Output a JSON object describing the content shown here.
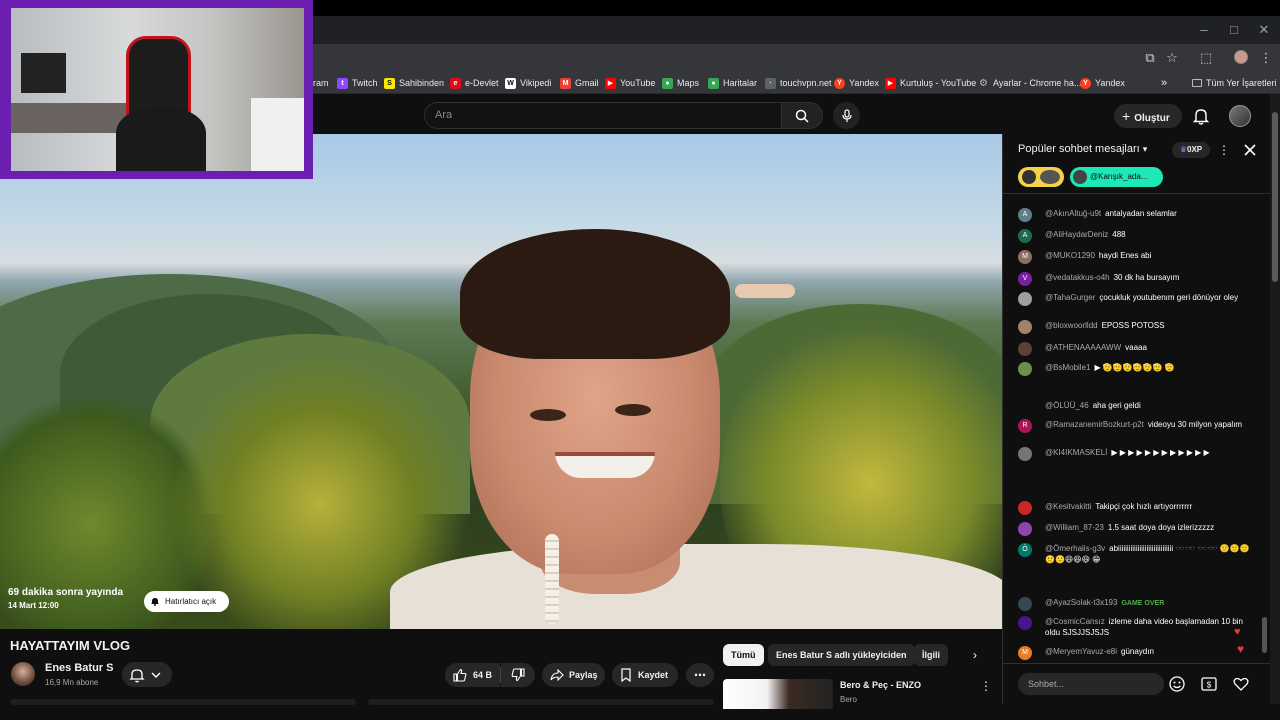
{
  "browser": {
    "window_controls": [
      "–",
      "□",
      "✕"
    ],
    "bookmarks": [
      {
        "label": "ram",
        "icon": "instagram-icon",
        "color": "#c13584"
      },
      {
        "label": "Twitch",
        "icon": "twitch-icon",
        "color": "#9146ff"
      },
      {
        "label": "Sahibinden",
        "icon": "sahibinden-icon",
        "color": "#ffe800"
      },
      {
        "label": "e-Devlet",
        "icon": "edevlet-icon",
        "color": "#e30a17"
      },
      {
        "label": "Vikipedi",
        "icon": "wikipedia-icon",
        "color": "#ffffff"
      },
      {
        "label": "Gmail",
        "icon": "gmail-icon",
        "color": "#ea4335"
      },
      {
        "label": "YouTube",
        "icon": "youtube-icon",
        "color": "#ff0000"
      },
      {
        "label": "Maps",
        "icon": "maps-icon",
        "color": "#34a853"
      },
      {
        "label": "Haritalar",
        "icon": "maps-icon",
        "color": "#34a853"
      },
      {
        "label": "touchvpn.net",
        "icon": "globe-icon",
        "color": "#5f6368"
      },
      {
        "label": "Yandex",
        "icon": "yandex-icon",
        "color": "#fc3f1d"
      },
      {
        "label": "Kurtuluş - YouTube",
        "icon": "youtube-icon",
        "color": "#ff0000"
      },
      {
        "label": "Ayarlar - Chrome ha...",
        "icon": "gear-icon",
        "color": "#9aa0a6"
      },
      {
        "label": "Yandex",
        "icon": "yandex-icon",
        "color": "#fc3f1d"
      }
    ],
    "more_bookmarks": "»",
    "all_bookmarks": "Tüm Yer İşaretleri"
  },
  "header": {
    "search_placeholder": "Ara",
    "create_label": "Oluştur"
  },
  "video": {
    "premiere_line1": "69 dakika sonra yayında",
    "premiere_line2": "14 Mart 12:00",
    "reminder_label": "Hatırlatıcı açık",
    "title": "HAYATTAYIM VLOG",
    "channel_name": "Enes Batur S",
    "channel_subs": "16,9 Mn abone",
    "like_count": "64 B",
    "share_label": "Paylaş",
    "save_label": "Kaydet"
  },
  "related": {
    "tabs": [
      "Tümü",
      "Enes Batur S adlı yükleyiciden",
      "İlgili"
    ],
    "first_title": "Bero & Peç - ENZO",
    "first_channel": "Bero"
  },
  "chat": {
    "header_title": "Popüler sohbet mesajları",
    "points_label": "0XP",
    "ticker_b_label": "@Karışık_ada...",
    "input_placeholder": "Sohbet...",
    "messages": [
      {
        "author": "@AkınAltuğ-u9t",
        "text": "antalyadan selamlar",
        "avatar": "A",
        "color": "#607d8b"
      },
      {
        "author": "@AliHaydarDeniz",
        "text": "488",
        "avatar": "A",
        "color": "#1e6b4a"
      },
      {
        "author": "@MUKO1290",
        "text": "haydi Enes abi",
        "avatar": "M",
        "color": "#8d6e63"
      },
      {
        "author": "@vedatakkus-o4h",
        "text": "30 dk ha bursayım",
        "avatar": "V",
        "color": "#7b1fa2"
      },
      {
        "author": "@TahaGurger",
        "text": "çocukluk youtubenım geri dönüyor oley",
        "avatar": "",
        "color": "#9e9e9e"
      },
      {
        "author": "@bloxwoorlldd",
        "text": "EPOSS POTOSS",
        "avatar": "",
        "color": "#a0836a"
      },
      {
        "author": "@ATHENAAAAAWW",
        "text": "vaaaa",
        "avatar": "",
        "color": "#5d4037"
      },
      {
        "author": "@BsMobile1",
        "text": "▶ 🫡🫡🫡🫡🫡🫡 🫡",
        "avatar": "",
        "color": "#6d8f4a"
      },
      {
        "author": "@ÖLÜÜ_46",
        "text": "aha geri geldi",
        "avatar": "",
        "color": "#0f0f0f"
      },
      {
        "author": "@RamazanemirBozkurt-p2t",
        "text": "videoyu 30 milyon yapalım",
        "avatar": "R",
        "color": "#ad1457"
      },
      {
        "author": "@KI4IKMASKELİ",
        "text": "▶ ▶ ▶ ▶ ▶ ▶ ▶ ▶ ▶ ▶ ▶ ▶",
        "avatar": "",
        "color": "#757575"
      },
      {
        "author": "@Kesitvakitti",
        "text": "Takipçi çok hızlı artıyorrrrrrr",
        "avatar": "",
        "color": "#c62828"
      },
      {
        "author": "@William_87-23",
        "text": "1.5 saat doya doya izlerizzzzz",
        "avatar": "",
        "color": "#8e44ad"
      },
      {
        "author": "@Ömerhalis-g3v",
        "text": "abiiiiiiiiiiiiiiiiiiiiiiiiiiiiiii 🕶️🕶️ 🕶️🕶️ 🙂🙂🙂🙂🙂😆😆😆 😁",
        "avatar": "Ö",
        "color": "#00796b"
      },
      {
        "author": "@AyazSolak-t3x193",
        "text": "GAME OVER",
        "avatar": "",
        "color": "#37474f"
      },
      {
        "author": "@CosmicCansız",
        "text": "izleme daha video başlamadan 10 bin oldu SJSJJSJSJS",
        "avatar": "",
        "color": "#4a148c"
      },
      {
        "author": "@MeryemYavuz-e8i",
        "text": "günaydın",
        "avatar": "M",
        "color": "#e67e22"
      }
    ]
  }
}
